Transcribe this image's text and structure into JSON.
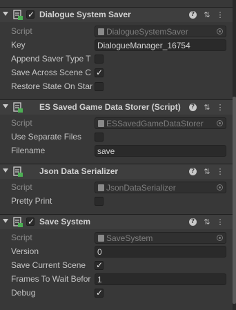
{
  "components": [
    {
      "title": "Dialogue System Saver",
      "enabled": true,
      "rows": [
        {
          "type": "object",
          "label": "Script",
          "value": "DialogueSystemSaver"
        },
        {
          "type": "text",
          "label": "Key",
          "value": "DialogueManager_16754"
        },
        {
          "type": "checkbox",
          "label": "Append Saver Type T",
          "checked": false
        },
        {
          "type": "checkbox",
          "label": "Save Across Scene C",
          "checked": true
        },
        {
          "type": "checkbox",
          "label": "Restore State On Star",
          "checked": false
        }
      ]
    },
    {
      "title": "ES Saved Game Data Storer (Script)",
      "enabled": null,
      "rows": [
        {
          "type": "object",
          "label": "Script",
          "value": "ESSavedGameDataStorer"
        },
        {
          "type": "checkbox",
          "label": "Use Separate Files",
          "checked": false
        },
        {
          "type": "text",
          "label": "Filename",
          "value": "save"
        }
      ]
    },
    {
      "title": "Json Data Serializer",
      "enabled": null,
      "rows": [
        {
          "type": "object",
          "label": "Script",
          "value": "JsonDataSerializer"
        },
        {
          "type": "checkbox",
          "label": "Pretty Print",
          "checked": false
        }
      ]
    },
    {
      "title": "Save System",
      "enabled": true,
      "rows": [
        {
          "type": "object",
          "label": "Script",
          "value": "SaveSystem"
        },
        {
          "type": "text",
          "label": "Version",
          "value": "0"
        },
        {
          "type": "checkbox",
          "label": "Save Current Scene",
          "checked": true
        },
        {
          "type": "text",
          "label": "Frames To Wait Befor",
          "value": "1"
        },
        {
          "type": "checkbox",
          "label": "Debug",
          "checked": true
        }
      ]
    }
  ],
  "icons": {
    "help": "help-icon",
    "settings": "preset-sliders-icon",
    "menu": "context-menu-icon",
    "script": "script-icon",
    "foldout": "foldout-arrow-icon"
  },
  "glyphs": {
    "check": "✓",
    "help": "?",
    "settings": "⇅",
    "menu": "⋮"
  }
}
